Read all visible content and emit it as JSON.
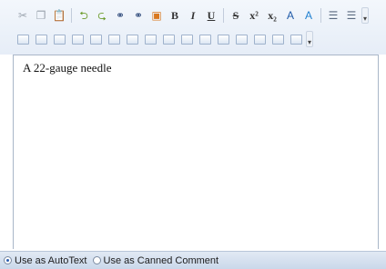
{
  "toolbar": {
    "row1": [
      {
        "name": "cut-icon",
        "glyph": "✂",
        "color": "#9aa3ad"
      },
      {
        "name": "copy-icon",
        "glyph": "❐",
        "color": "#9aa3ad"
      },
      {
        "name": "paste-icon",
        "glyph": "📋",
        "color": "#b08a3a"
      },
      {
        "sep": true
      },
      {
        "name": "undo-icon",
        "glyph": "⮌",
        "color": "#6a9a28"
      },
      {
        "name": "redo-icon",
        "glyph": "⮎",
        "color": "#6a9a28"
      },
      {
        "name": "link-icon",
        "glyph": "⚭",
        "color": "#2e4a7a"
      },
      {
        "name": "unlink-icon",
        "glyph": "⚭",
        "color": "#2e4a7a"
      },
      {
        "name": "insert-image-icon",
        "glyph": "▣",
        "color": "#d9781f"
      },
      {
        "name": "bold-button",
        "glyph": "B",
        "color": "#333333",
        "fmt": true
      },
      {
        "name": "italic-button",
        "glyph": "I",
        "color": "#333333",
        "fmt": true,
        "italic": true
      },
      {
        "name": "underline-button",
        "glyph": "U",
        "color": "#333333",
        "fmt": true,
        "underline": true
      },
      {
        "sep": true
      },
      {
        "name": "strikethrough-button",
        "glyph": "S",
        "color": "#333333",
        "fmt": true,
        "strike": true
      },
      {
        "name": "superscript-button",
        "glyph": "x²",
        "color": "#333333",
        "fmt": true
      },
      {
        "name": "subscript-button",
        "glyph": "x₂",
        "color": "#333333",
        "fmt": true
      },
      {
        "name": "font-color-icon",
        "glyph": "A",
        "color": "#1f5aa8"
      },
      {
        "name": "highlight-color-icon",
        "glyph": "A",
        "color": "#1e7fd0"
      },
      {
        "sep": true
      },
      {
        "name": "numbered-list-icon",
        "glyph": "☰",
        "color": "#5a6a80"
      },
      {
        "name": "bulleted-list-icon",
        "glyph": "☰",
        "color": "#5a6a80"
      }
    ],
    "row2_count": 16,
    "row2_icon_names": [
      "table-insert-icon",
      "table-props-icon",
      "row-above-icon",
      "row-below-icon",
      "col-left-icon",
      "col-right-icon",
      "delete-row-icon",
      "delete-col-icon",
      "split-cells-icon",
      "merge-cells-icon",
      "cell-props-icon",
      "table-border-icon",
      "align-left-icon",
      "align-center-icon",
      "align-right-icon",
      "justify-icon"
    ],
    "overflow_label": "▾"
  },
  "editor": {
    "content": "A 22-gauge needle"
  },
  "footer": {
    "options": [
      {
        "label": "Use as AutoText",
        "selected": true
      },
      {
        "label": "Use as Canned Comment",
        "selected": false
      }
    ]
  }
}
